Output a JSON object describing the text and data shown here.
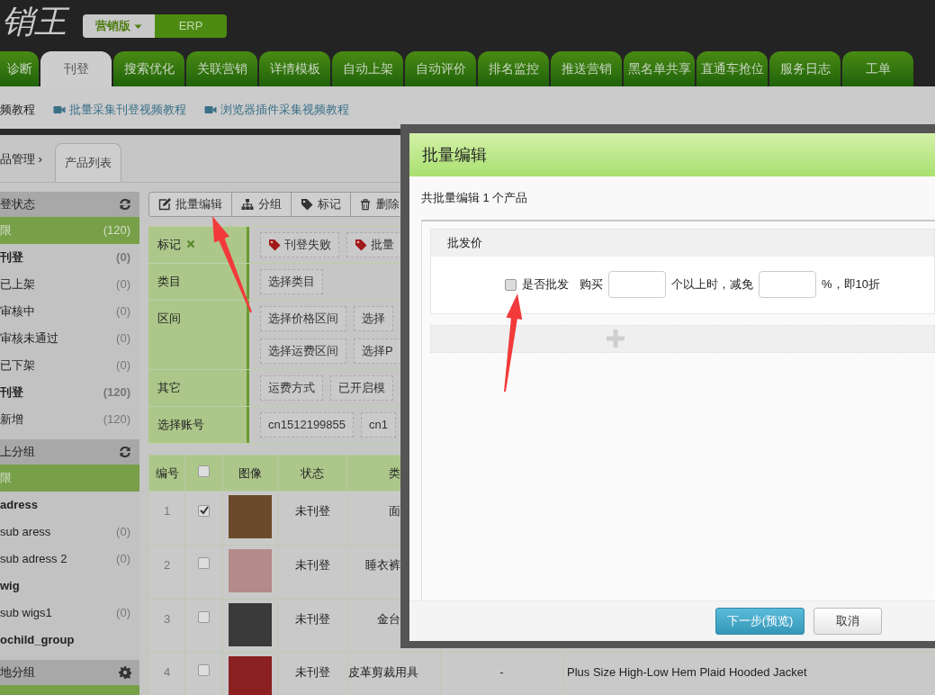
{
  "logo": {
    "text": "销王"
  },
  "edition_switch": [
    {
      "label": "营销版",
      "selected": true
    },
    {
      "label": "ERP",
      "selected": false
    }
  ],
  "nav_tabs": [
    {
      "label": "诊断",
      "selected": false
    },
    {
      "label": "刊登",
      "selected": true
    },
    {
      "label": "搜索优化",
      "selected": false
    },
    {
      "label": "关联营销",
      "selected": false
    },
    {
      "label": "详情模板",
      "selected": false
    },
    {
      "label": "自动上架",
      "selected": false
    },
    {
      "label": "自动评价",
      "selected": false
    },
    {
      "label": "排名监控",
      "selected": false
    },
    {
      "label": "推送营销",
      "selected": false
    },
    {
      "label": "黑名单共享",
      "selected": false
    },
    {
      "label": "直通车抢位",
      "selected": false
    },
    {
      "label": "服务日志",
      "selected": false
    },
    {
      "label": "工单",
      "selected": false
    }
  ],
  "tutorial_links": [
    {
      "kind": "text",
      "label": "频教程"
    },
    {
      "kind": "video",
      "label": "批量采集刊登视频教程"
    },
    {
      "kind": "video",
      "label": "浏览器插件采集视频教程"
    }
  ],
  "breadcrumb": {
    "parent": "品管理",
    "separator": "›",
    "current": "产品列表"
  },
  "sidebar": {
    "sections": [
      {
        "title": "登状态",
        "items": [
          {
            "kind": "item",
            "label": "限",
            "count": "(120)",
            "selected": true
          },
          {
            "kind": "group",
            "label": "刊登",
            "count": "(0)",
            "selected": false
          },
          {
            "kind": "item",
            "label": "已上架",
            "count": "(0)",
            "selected": false
          },
          {
            "kind": "item",
            "label": "审核中",
            "count": "(0)",
            "selected": false
          },
          {
            "kind": "item",
            "label": "审核未通过",
            "count": "(0)",
            "selected": false
          },
          {
            "kind": "item",
            "label": "已下架",
            "count": "(0)",
            "selected": false
          },
          {
            "kind": "group",
            "label": "刊登",
            "count": "(120)",
            "selected": false
          },
          {
            "kind": "item",
            "label": "新增",
            "count": "(120)",
            "selected": false
          }
        ]
      },
      {
        "title": "上分组",
        "items": [
          {
            "kind": "item",
            "label": "限",
            "selected": true
          },
          {
            "kind": "group",
            "label": "adress",
            "selected": false
          },
          {
            "kind": "item",
            "label": "sub aress",
            "count": "(0)",
            "selected": false
          },
          {
            "kind": "item",
            "label": "sub adress 2",
            "count": "(0)",
            "selected": false
          },
          {
            "kind": "group",
            "label": "wig",
            "selected": false
          },
          {
            "kind": "item",
            "label": "sub wigs1",
            "count": "(0)",
            "selected": false
          },
          {
            "kind": "group",
            "label": "ochild_group",
            "selected": false
          }
        ]
      },
      {
        "title": "地分组",
        "items": [
          {
            "kind": "item",
            "selected": true
          }
        ]
      }
    ]
  },
  "toolbar": [
    {
      "label": "批量编辑"
    },
    {
      "label": "分组"
    },
    {
      "label": "标记"
    },
    {
      "label": "删除"
    }
  ],
  "filters": [
    {
      "label": "标记",
      "removable": true,
      "options": [
        {
          "label": "刊登失败",
          "tagged": true
        },
        {
          "label": "批量",
          "tagged": true
        }
      ]
    },
    {
      "label": "类目",
      "removable": false,
      "options": [
        {
          "label": "选择类目",
          "tagged": false
        }
      ]
    },
    {
      "label": "区间",
      "removable": false,
      "options": [
        {
          "label": "选择价格区间",
          "tagged": false
        },
        {
          "label": "选择",
          "tagged": false
        },
        {
          "label": "选择运费区间",
          "tagged": false
        },
        {
          "label": "选择P",
          "tagged": false
        }
      ]
    },
    {
      "label": "其它",
      "removable": false,
      "options": [
        {
          "label": "运费方式",
          "tagged": false
        },
        {
          "label": "已开启模",
          "tagged": false
        }
      ]
    },
    {
      "label": "选择账号",
      "removable": false,
      "options": [
        {
          "label": "cn1512199855",
          "tagged": false
        },
        {
          "label": "cn1",
          "tagged": false
        }
      ]
    }
  ],
  "product_table": {
    "columns": [
      {
        "kind": "text",
        "label": "编号"
      },
      {
        "kind": "checkbox",
        "checked": false
      },
      {
        "kind": "text",
        "label": "图像"
      },
      {
        "kind": "text",
        "label": "状态"
      },
      {
        "kind": "text",
        "label": "类"
      }
    ],
    "rows": [
      {
        "no": "1",
        "checked": true,
        "status": "未刊登",
        "category": "面"
      },
      {
        "no": "2",
        "checked": false,
        "status": "未刊登",
        "category": "睡衣裤"
      },
      {
        "no": "3",
        "checked": false,
        "status": "未刊登",
        "category": "金台"
      },
      {
        "no": "4",
        "checked": false,
        "status": "未刊登",
        "category": "皮革剪裁用具",
        "column_6": "-",
        "title": "Plus Size High-Low Hem Plaid Hooded Jacket"
      }
    ]
  },
  "modal": {
    "title": "批量编辑",
    "summary": "共批量编辑 1 个产品",
    "panel_title": "批发价",
    "row": [
      {
        "kind": "checkbox",
        "label": "是否批发",
        "checked": false
      },
      {
        "kind": "text",
        "text": "购买"
      },
      {
        "kind": "input"
      },
      {
        "kind": "text",
        "text": "个以上时，减免"
      },
      {
        "kind": "input"
      },
      {
        "kind": "text",
        "text": "%，即10折"
      }
    ],
    "buttons": [
      {
        "kind": "primary",
        "label": "下一步(预览)"
      },
      {
        "kind": "default",
        "label": "取消"
      }
    ]
  }
}
